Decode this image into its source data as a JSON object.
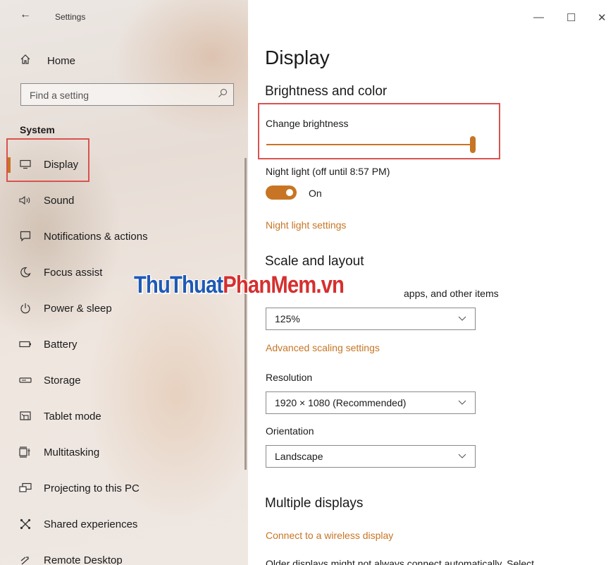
{
  "window": {
    "title": "Settings",
    "minimize": "—",
    "maximize": "☐",
    "close": "✕"
  },
  "sidebar": {
    "home": "Home",
    "search_placeholder": "Find a setting",
    "section_label": "System",
    "items": [
      {
        "label": "Display",
        "icon": "monitor-icon",
        "active": true
      },
      {
        "label": "Sound",
        "icon": "speaker-icon"
      },
      {
        "label": "Notifications & actions",
        "icon": "message-icon"
      },
      {
        "label": "Focus assist",
        "icon": "moon-icon"
      },
      {
        "label": "Power & sleep",
        "icon": "power-icon"
      },
      {
        "label": "Battery",
        "icon": "battery-icon"
      },
      {
        "label": "Storage",
        "icon": "storage-icon"
      },
      {
        "label": "Tablet mode",
        "icon": "tablet-icon"
      },
      {
        "label": "Multitasking",
        "icon": "multitasking-icon"
      },
      {
        "label": "Projecting to this PC",
        "icon": "project-icon"
      },
      {
        "label": "Shared experiences",
        "icon": "shared-icon"
      },
      {
        "label": "Remote Desktop",
        "icon": "remote-desktop-icon"
      }
    ]
  },
  "main": {
    "title": "Display",
    "brightness_heading": "Brightness and color",
    "brightness_label": "Change brightness",
    "brightness_value": 1.0,
    "night_light_label": "Night light (off until 8:57 PM)",
    "night_light_state": "On",
    "night_light_link": "Night light settings",
    "scale_heading": "Scale and layout",
    "scale_label_visible": "apps, and other items",
    "scale_value": "125%",
    "advanced_scaling_link": "Advanced scaling settings",
    "resolution_label": "Resolution",
    "resolution_value": "1920 × 1080 (Recommended)",
    "orientation_label": "Orientation",
    "orientation_value": "Landscape",
    "multiple_heading": "Multiple displays",
    "wireless_link": "Connect to a wireless display",
    "cut_text": "Older displays might not always connect automatically. Select"
  },
  "watermark": {
    "part1": "ThuThuat",
    "part2": "PhanMem",
    "part3": ".vn"
  },
  "colors": {
    "accent": "#c77524",
    "highlight_box": "#d9534f",
    "watermark_blue": "#1f59b5",
    "watermark_red": "#d62f2f"
  }
}
